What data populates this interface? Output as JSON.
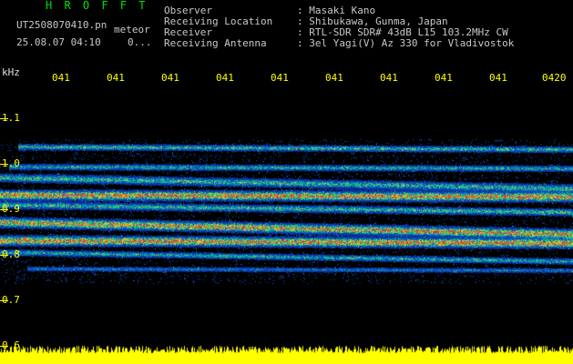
{
  "app": {
    "name": "H R O F F T"
  },
  "file": {
    "name": "UT2508070410.pn",
    "event": "meteor",
    "datetime": "25.08.07 04:10",
    "count": "0..."
  },
  "info": [
    {
      "label": "Observer",
      "value": ": Masaki Kano"
    },
    {
      "label": "Receiving Location",
      "value": ": Shibukawa, Gunma, Japan"
    },
    {
      "label": "Receiver",
      "value": ": RTL-SDR SDR# 43dB L15 103.2MHz CW"
    },
    {
      "label": "Receiving Antenna",
      "value": ": 3el Yagi(V) Az 330 for Vladivostok"
    }
  ],
  "spectrogram": {
    "unit": "kHz",
    "time_ticks": [
      "041",
      "041",
      "041",
      "041",
      "041",
      "041",
      "041",
      "041",
      "041",
      "0420"
    ],
    "freq_ticks": [
      "1.1",
      "1.0",
      "0.9",
      "0.8",
      "0.7",
      "0.6"
    ],
    "colors": {
      "background": "#000000",
      "signal_low": "#1a2a9a",
      "signal_mid": "#00c060",
      "signal_high": "#ff2020",
      "axis": "#ffff00"
    }
  }
}
